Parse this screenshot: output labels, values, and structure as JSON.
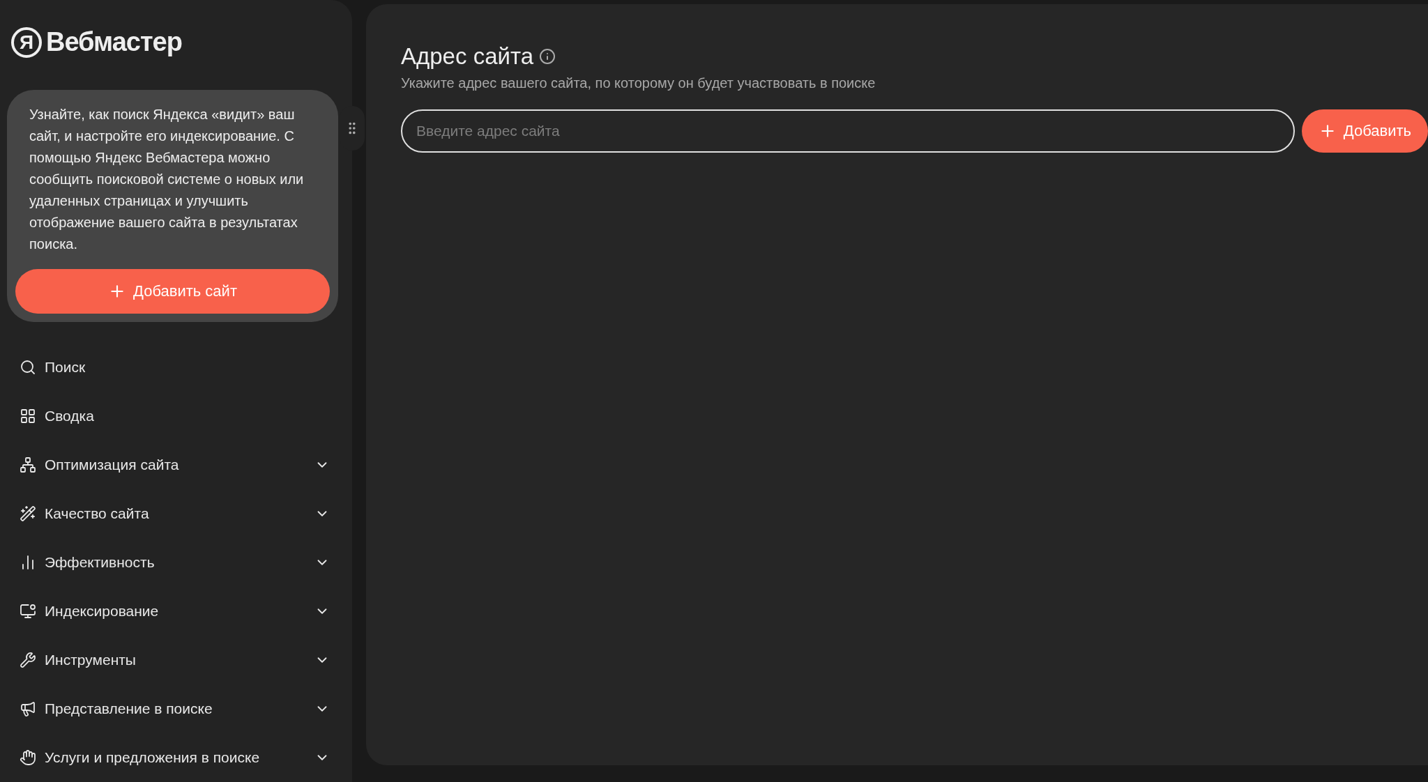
{
  "logo": {
    "mark": "Я",
    "title": "Вебмастер"
  },
  "promo": {
    "text": "Узнайте, как поиск Яндекса «видит» ваш сайт, и настройте его индексирование. С помощью Яндекс Вебмастера можно сообщить поисковой системе о новых или удаленных страницах и улучшить отображение вашего сайта в результатах поиска.",
    "button": "Добавить сайт"
  },
  "nav": [
    {
      "label": "Поиск"
    },
    {
      "label": "Сводка"
    },
    {
      "label": "Оптимизация сайта",
      "expanded": false
    },
    {
      "label": "Качество сайта",
      "expanded": false
    },
    {
      "label": "Эффективность",
      "expanded": false
    },
    {
      "label": "Индексирование",
      "expanded": false
    },
    {
      "label": "Инструменты",
      "expanded": false
    },
    {
      "label": "Представление в поиске",
      "expanded": false
    },
    {
      "label": "Услуги и предложения в поиске",
      "expanded": false
    }
  ],
  "main": {
    "title": "Адрес сайта",
    "subtitle": "Укажите адрес вашего сайта, по которому он будет участвовать в поиске",
    "input": {
      "placeholder": "Введите адрес сайта"
    },
    "button": "Добавить"
  }
}
